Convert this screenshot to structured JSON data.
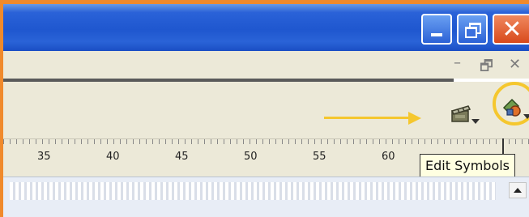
{
  "window": {
    "controls": {
      "minimize_icon": "minimize-icon",
      "restore_icon": "restore-icon",
      "close_icon": "close-icon",
      "close_glyph": "✕"
    },
    "mdi_controls": {
      "minimize_glyph": "–",
      "restore_glyph": "🗗",
      "close_glyph": "✕"
    },
    "colors": {
      "titlebar": "#2a62d8",
      "close_button": "#d84a1c",
      "highlight": "#f5c72e"
    }
  },
  "toolbar": {
    "edit_scene_icon": "clapperboard-icon",
    "edit_symbols_icon": "edit-symbols-icon"
  },
  "ruler": {
    "labels": [
      "35",
      "40",
      "45",
      "50",
      "55",
      "60"
    ]
  },
  "tooltip": {
    "text": "Edit Symbols"
  }
}
